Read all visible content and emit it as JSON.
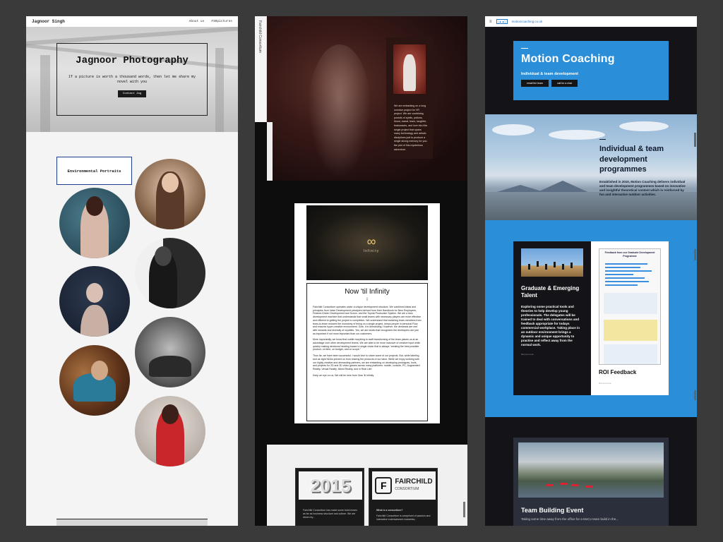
{
  "panel1": {
    "brand": "Jagnoor Singh",
    "nav": [
      "About us",
      "#30pictures"
    ],
    "hero": {
      "title": "Jagnoor Photography",
      "subtitle": "If a picture is worth a thousand words, then let me share my novel with you",
      "button": "Contact Jag"
    },
    "section_label": "Environmental Portraits"
  },
  "panel2": {
    "side_label": "Fairchild Consortium",
    "hero_text": "We are embarking on a long overdue project for VR project. We are combining pounds of spells, potions, blood, sweat, tears, laughter, brainwaves, and love into this single project that spans many technology and artistic disciplines just to produce a single strong memory for you: the plot of this mysterious adventure.",
    "infinity_word": "Infinity",
    "article_title": "Now 'til Infinity",
    "article_paragraphs": [
      "Fairchild Consortium operates under a unique development structure. We combined ideas and principles from Valve Development principles derived from their Handbook for New Employees, Feature-Driven Development and Scrum, and the Toyota Production System. We are a lean development machine that understands that small teams with necessary players are more effective and efficient to getting the project to completion. We understand that switching team-members from team-to-team reduces the monotony of being on a single project, keeps people in personal Flow, and ensures hyper-creative environment. Sure, it is demanding. However, the demands are met with rewards and diversity of royalties. Yes, we are studio that recognizes the developers are just as important if not more important than our customers.",
      "More importantly, we know that subtle morphing to swift transforming of the team places us at an advantage over other development teams. We are able to be more inclusive of creative input while quickly making decisions heading toward a single vision that is always \"creating the best possible product- on time, on budget, and on scope.\"",
      "Thus far, we have been successful. I would love to share some of our projects. But, while labeling and air-tight NDAs prevent us from sharing the products of our labor. While we enjoy working with our highly creative and demanding partners, we are embarking on developing prototypes, tools, and projects for 2D and 3D video games across many platforms: mobile, console, PC, Augmented Reality, Virtual Reality, Mixed Reality, and in Real Life!",
      "Keep an eye on us. We will be here from Now 'til Infinity."
    ],
    "tile1_logo": "2015",
    "tile1_text": "Fairchild Consortium has made some bold moves as far as business structure and culture. We are driven by...",
    "tile2_logo": "FAIRCHILD",
    "tile2_logo_sub": "CONSORTIUM",
    "tile2_heading": "What is a consortium?",
    "tile2_text": "Fairchild Consortium is comprised of passion and interactive entertainment industries..."
  },
  "panel3": {
    "url": "motioncoaching.co.uk",
    "hero": {
      "title": "Motion Coaching",
      "tagline": "Individual & team development",
      "buttons": [
        "email the team",
        "call for a chat"
      ]
    },
    "programmes": {
      "title": "Individual & team development programmes",
      "text": "Established in 2010, Motion Coaching delivers individual and team development programmes based on innovative and insightful theoretical content which is reinforced by fun and interactive outdoor activities."
    },
    "graduate": {
      "title": "Graduate & Emerging Talent",
      "text": "Exploring some practical tools and theories to help develop young professionals. The delegates will be trained to deal with conversations and feedback appropriate for todays commercial workplace. Taking place in an outdoor environment brings a dynamic and unique opportunity to practise and reflect away from the normal work.",
      "more": "find out more"
    },
    "poster_heading": "Feedback from our Graduate Development Programme",
    "roi": {
      "title": "ROI Feedback",
      "more": "find out more"
    },
    "team": {
      "title": "Team Building Event",
      "text": "Taking some time away from the office for a MoCo team build in the..."
    },
    "accent": "#2a8fd8"
  }
}
